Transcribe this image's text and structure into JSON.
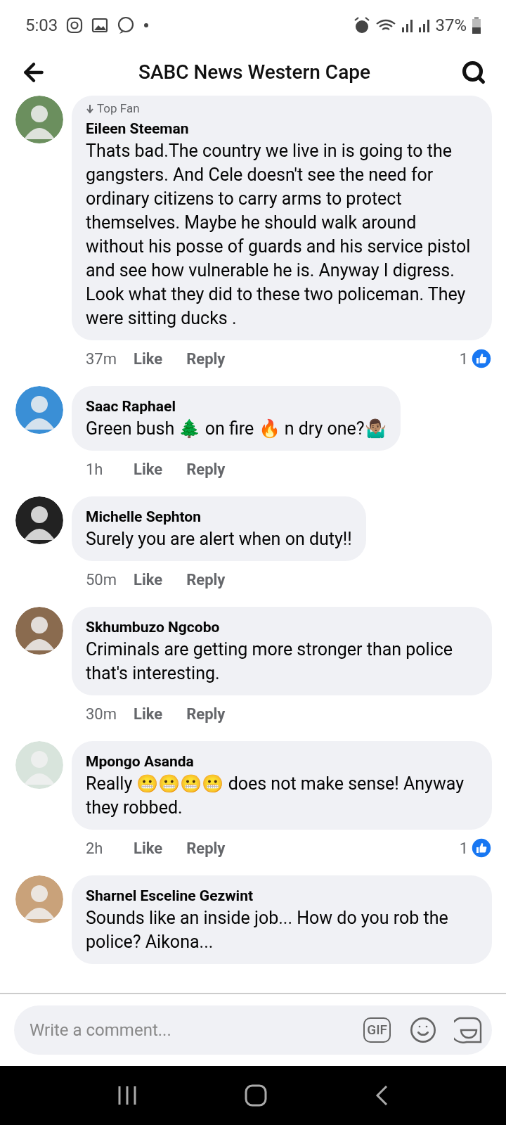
{
  "status_bar": {
    "time": "5:03",
    "battery": "37%"
  },
  "header": {
    "title": "SABC News Western Cape"
  },
  "comments": [
    {
      "badge": "Top Fan",
      "name": "Eileen Steeman",
      "text": "Thats bad.The country we live in is going to the gangsters. And Cele doesn't see the need for ordinary citizens to carry arms to protect themselves. Maybe he should walk around without his posse of guards and his service pistol and see how vulnerable he is. Anyway I digress. Look what they did to these two policeman. They were sitting ducks  .",
      "time": "37m",
      "like": "Like",
      "reply": "Reply",
      "reactions": "1"
    },
    {
      "name": "Saac Raphael",
      "text": "Green bush 🌲 on fire 🔥 n dry one?🤷🏽‍♂️",
      "time": "1h",
      "like": "Like",
      "reply": "Reply"
    },
    {
      "name": "Michelle Sephton",
      "text": "Surely you are alert when on duty!!",
      "time": "50m",
      "like": "Like",
      "reply": "Reply"
    },
    {
      "name": "Skhumbuzo Ngcobo",
      "text": "Criminals  are getting  more stronger than police that's interesting.",
      "time": "30m",
      "like": "Like",
      "reply": "Reply"
    },
    {
      "name": "Mpongo Asanda",
      "text": "Really 😬😬😬😬 does not make sense! Anyway they robbed.",
      "time": "2h",
      "like": "Like",
      "reply": "Reply",
      "reactions": "1"
    },
    {
      "name": "Sharnel Esceline Gezwint",
      "text": "Sounds like an inside job... How do you rob the police? Aikona..."
    }
  ],
  "composer": {
    "placeholder": "Write a comment...",
    "gif": "GIF"
  }
}
